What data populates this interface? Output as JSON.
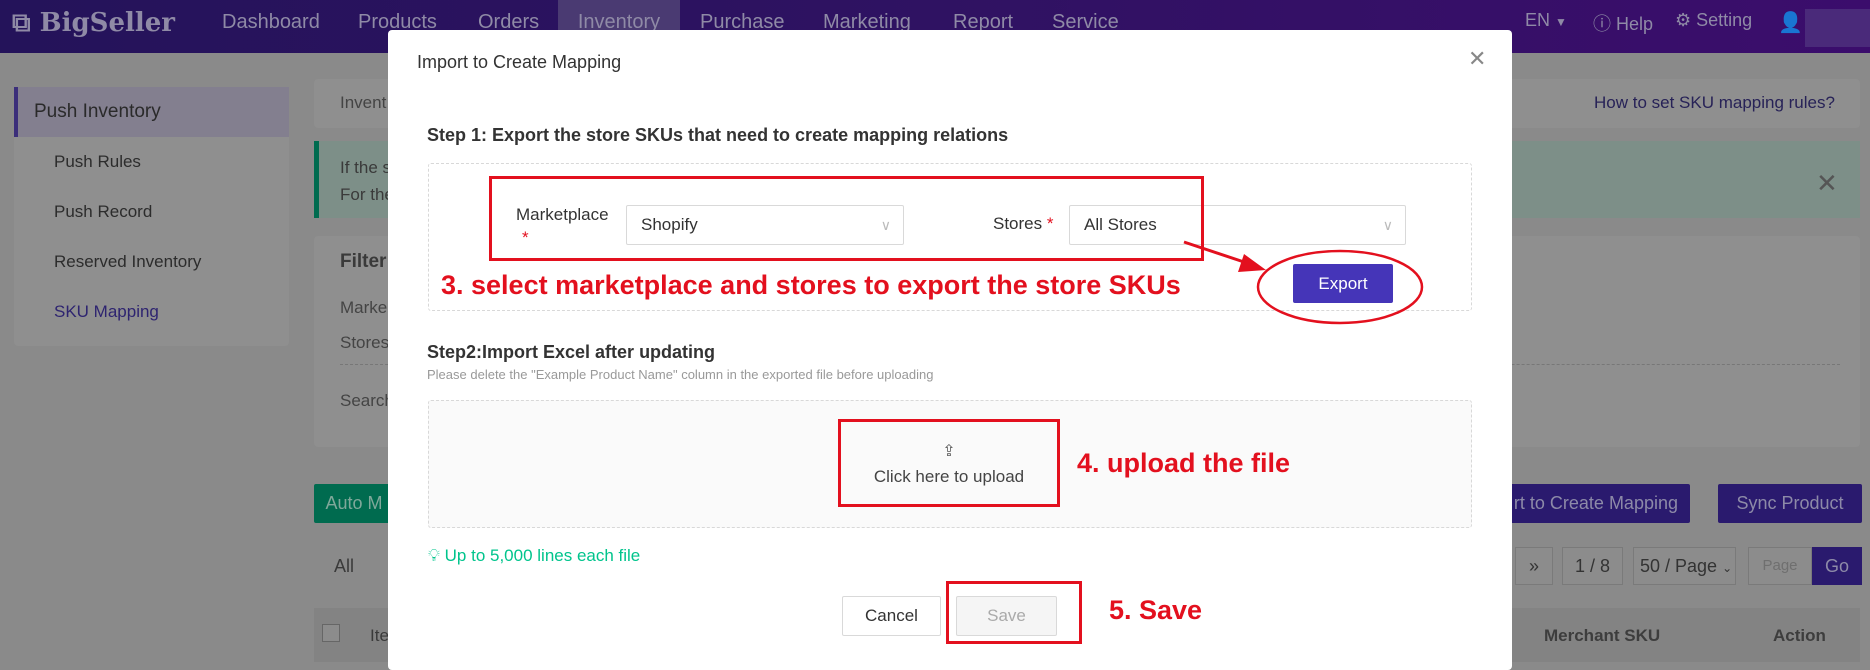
{
  "nav": {
    "logo": "BigSeller",
    "items": [
      "Dashboard",
      "Products",
      "Orders",
      "Inventory",
      "Purchase",
      "Marketing",
      "Report",
      "Service"
    ],
    "active": "Inventory",
    "lang": "EN",
    "help": "Help",
    "setting": "Setting"
  },
  "sidebar": {
    "section": "Push Inventory",
    "items": [
      "Push Rules",
      "Push Record",
      "Reserved Inventory",
      "SKU Mapping"
    ],
    "active": "SKU Mapping"
  },
  "main": {
    "breadcrumb": "Invent",
    "help_link": "How to set SKU mapping rules?",
    "alert_line1": "If the s",
    "alert_line2": "For the",
    "filter_title": "Filter",
    "filter_marketplace": "Marke",
    "filter_stores": "Stores",
    "filter_search": "Search",
    "auto_button": "Auto M",
    "import_button": "rt to Create Mapping",
    "sync_button": "Sync Product",
    "tab_all": "All",
    "pagination": {
      "next": "»",
      "current": "1 / 8",
      "per_page": "50 / Page",
      "page_placeholder": "Page",
      "go": "Go"
    },
    "table_headers": [
      "Ite",
      "Merchant SKU",
      "Action"
    ]
  },
  "modal": {
    "title": "Import to Create Mapping",
    "step1": "Step 1: Export the store SKUs that need to create mapping relations",
    "marketplace_label": "Marketplace",
    "marketplace_value": "Shopify",
    "stores_label": "Stores",
    "stores_value": "All Stores",
    "required": "*",
    "export_button": "Export",
    "step2": "Step2:Import Excel after updating",
    "step2_note": "Please delete the \"Example Product Name\" column in the exported file before uploading",
    "upload_text": "Click here to upload",
    "tip": "Up to 5,000 lines each file",
    "cancel": "Cancel",
    "save": "Save"
  },
  "annotations": {
    "step3": "3. select marketplace and stores to export the store SKUs",
    "step4": "4. upload the file",
    "step5": "5. Save"
  },
  "colors": {
    "primary": "#4535b8",
    "annotation": "#e3101e",
    "tip": "#00c48c"
  }
}
